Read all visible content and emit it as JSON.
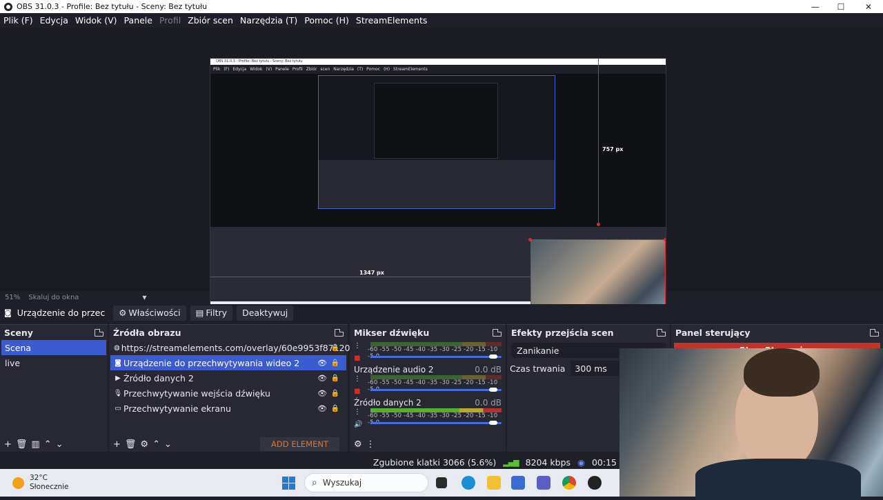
{
  "window": {
    "title": "OBS 31.0.3 - Profile: Bez tytułu - Sceny: Bez tytułu",
    "minimize": "—",
    "maximize": "☐",
    "close": "✕"
  },
  "menu": [
    "Plik (F)",
    "Edycja",
    "Widok (V)",
    "Panele",
    "Profil",
    "Zbiór scen",
    "Narzędzia (T)",
    "Pomoc (H)",
    "StreamElements"
  ],
  "preview": {
    "inner_title": "OBS 31.0.3 - Profile: Bez tytułu - Sceny: Bez tytułu",
    "inner_menu": "Plik (F) Edycja Widok (V) Panele Profil Zbiór scen Narzędzia (T) Pomoc (H) StreamElements",
    "height_label": "757 px",
    "width_label": "1347 px"
  },
  "zoom": {
    "percent": "51%",
    "mode": "Skaluj do okna"
  },
  "source_toolbar": {
    "source_name": "Urządzenie do przec",
    "properties": "Właściwości",
    "filters": "Filtry",
    "deactivate": "Deaktywuj"
  },
  "scenes": {
    "title": "Sceny",
    "items": [
      "Scena",
      "live"
    ],
    "selected": 0
  },
  "sources": {
    "title": "Źródła obrazu",
    "items": [
      {
        "label": "https://streamelements.com/overlay/60e9953f871202",
        "icon": "globe-icon",
        "visible": false
      },
      {
        "label": "Urządzenie do przechwytywania wideo 2",
        "icon": "camera-icon",
        "visible": true
      },
      {
        "label": "Źródło danych 2",
        "icon": "play-icon",
        "visible": true
      },
      {
        "label": "Przechwytywanie wejścia dźwięku",
        "icon": "mic-icon",
        "visible": true
      },
      {
        "label": "Przechwytywanie ekranu",
        "icon": "monitor-icon",
        "visible": true
      }
    ],
    "selected": 1,
    "add_element": "ADD ELEMENT"
  },
  "mixer": {
    "title": "Mikser dźwięku",
    "scale": "-60 -55 -50 -45 -40 -35 -30 -25 -20 -15 -10 -5 0",
    "channels": [
      {
        "name": "",
        "db": "",
        "muted": true,
        "active": false
      },
      {
        "name": "Urządzenie audio 2",
        "db": "0.0 dB",
        "muted": true,
        "active": false
      },
      {
        "name": "Źródło danych 2",
        "db": "0.0 dB",
        "muted": false,
        "active": true
      }
    ]
  },
  "transitions": {
    "title": "Efekty przejścia scen",
    "selected": "Zanikanie",
    "duration_label": "Czas trwania",
    "duration_value": "300 ms"
  },
  "controls": {
    "title": "Panel sterujący",
    "stop_streaming": "Stop Streaming"
  },
  "status": {
    "dropped_frames": "Zgubione klatki 3066 (5.6%)",
    "bitrate": "8204 kbps",
    "time": "00:15"
  },
  "taskbar": {
    "temperature": "32°C",
    "condition": "Słonecznie",
    "search": "Wyszukaj"
  },
  "colors": {
    "accent": "#3b5bd0",
    "stop": "#c2332a",
    "add_element": "#d87a2f",
    "selection_red": "#d42a2a"
  }
}
